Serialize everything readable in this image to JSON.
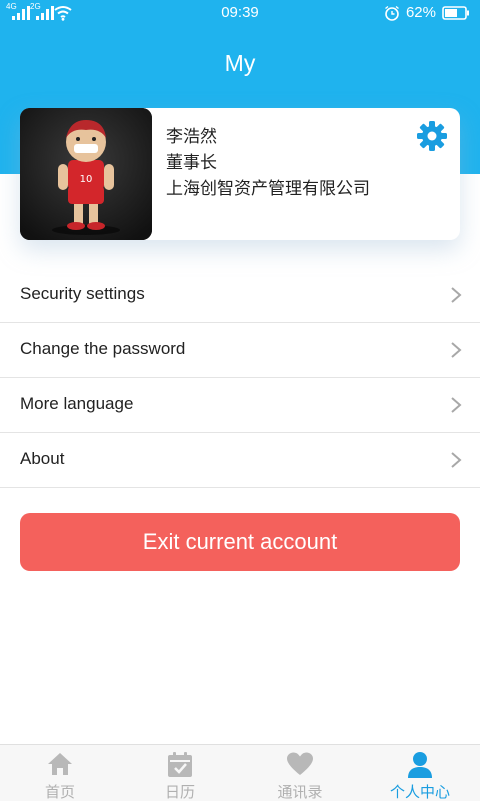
{
  "status_bar": {
    "time": "09:39",
    "net1": "4G",
    "net2": "2G",
    "battery": "62%",
    "icons": [
      "signal-icon",
      "signal-icon",
      "wifi-icon",
      "alarm-icon",
      "battery-icon"
    ]
  },
  "header": {
    "title": "My"
  },
  "profile": {
    "name": "李浩然",
    "position": "董事长",
    "company": "上海创智资产管理有限公司",
    "settings_icon": "gear-icon"
  },
  "menu": {
    "items": [
      {
        "label": "Security settings"
      },
      {
        "label": "Change the password"
      },
      {
        "label": "More language"
      },
      {
        "label": "About"
      }
    ]
  },
  "exit_button": {
    "label": "Exit current account"
  },
  "tabs": [
    {
      "label": "首页",
      "icon": "home-icon",
      "active": false
    },
    {
      "label": "日历",
      "icon": "calendar-icon",
      "active": false
    },
    {
      "label": "通讯录",
      "icon": "heart-icon",
      "active": false
    },
    {
      "label": "个人中心",
      "icon": "person-icon",
      "active": true
    }
  ],
  "colors": {
    "primary": "#1fb3ee",
    "exit": "#f4615c",
    "tab_active": "#1a9de0",
    "tab_inactive": "#b0b0b0"
  }
}
